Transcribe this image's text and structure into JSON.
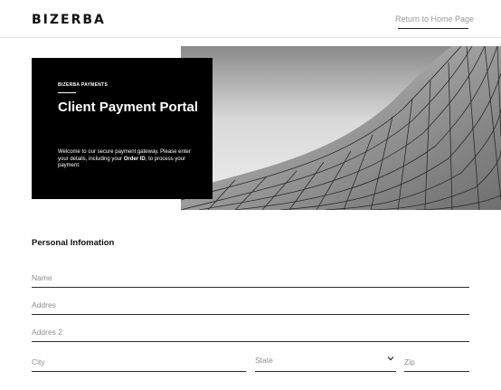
{
  "header": {
    "logo_text": "BIZERBA",
    "home_link": "Return to Home Page"
  },
  "hero": {
    "eyebrow": "BIZERBA PAYMENTS",
    "title": "Client Payment Portal",
    "desc_before": "Welcome to our secure payment gateway. Please enter your details, including your ",
    "desc_bold": "Order ID",
    "desc_after": ", to process your payment.",
    "image_icon": "building-photo"
  },
  "form": {
    "section_title": "Personal Infomation",
    "name_placeholder": "Name",
    "address_placeholder": "Addres",
    "address2_placeholder": "Addres 2",
    "city_placeholder": "City",
    "state_label": "State",
    "state_icon": "chevron-down-icon",
    "zip_placeholder": "Zip"
  }
}
